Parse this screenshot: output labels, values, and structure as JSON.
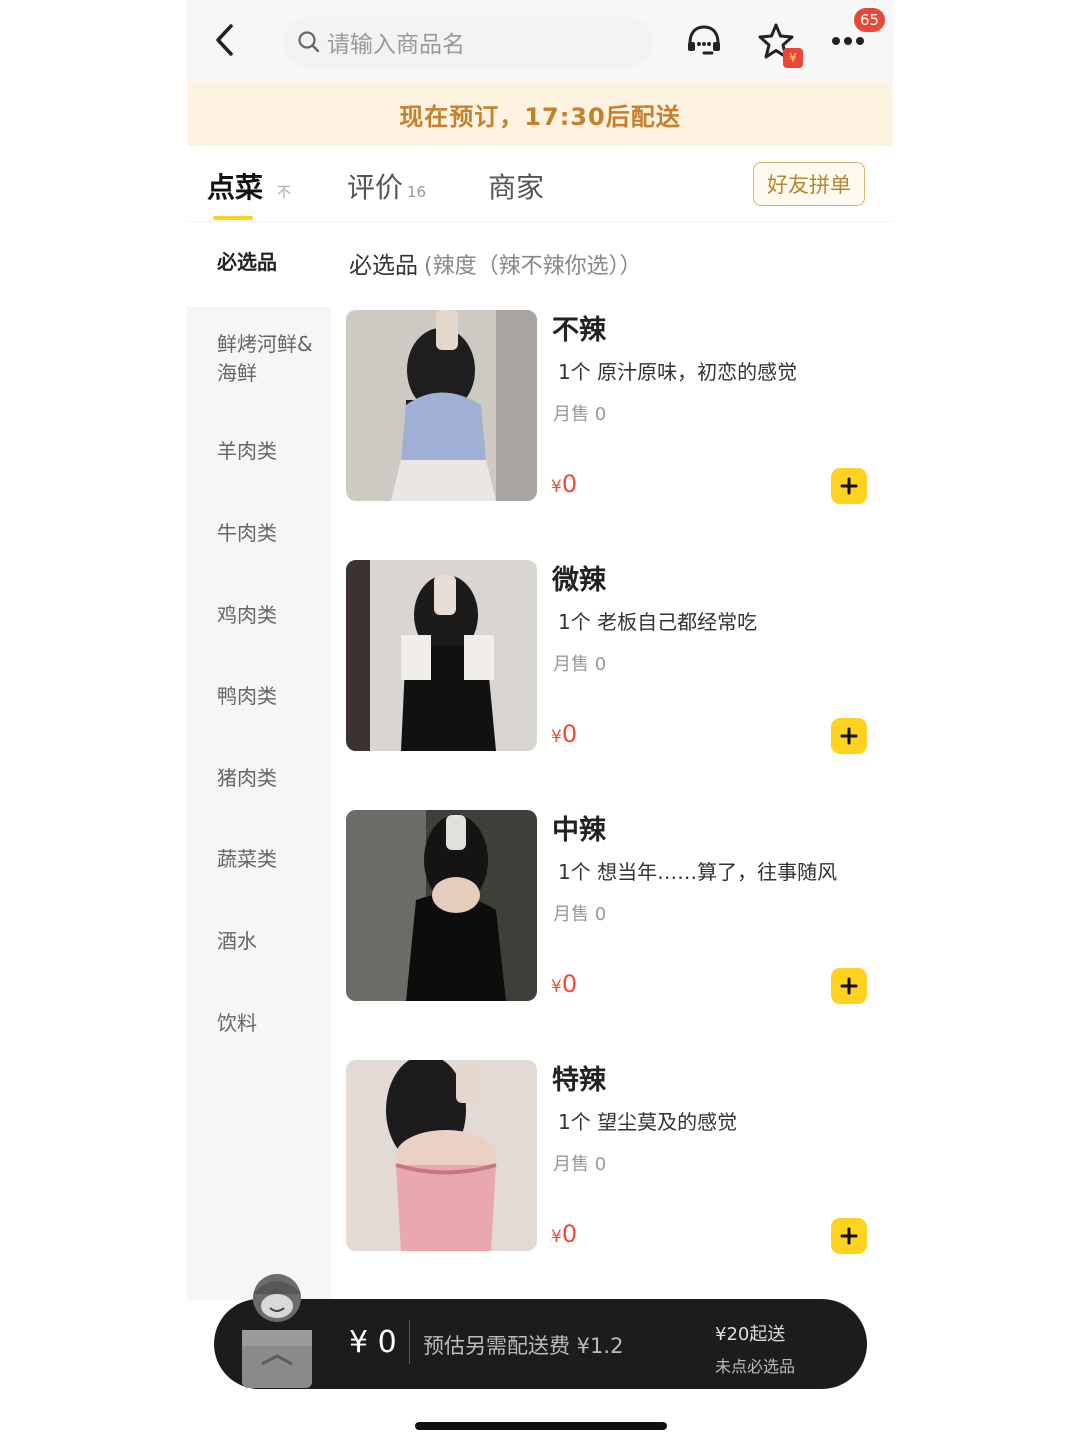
{
  "search": {
    "placeholder": "请输入商品名"
  },
  "header": {
    "badge_count": "65",
    "redpacket_label": "¥"
  },
  "banner": {
    "text": "现在预订，17:30后配送"
  },
  "tabs": {
    "order": "点菜",
    "order_pin": "不",
    "reviews": "评价",
    "reviews_count": "16",
    "merchant": "商家",
    "friend_button": "好友拼单"
  },
  "sidebar": {
    "items": [
      {
        "label": "必选品"
      },
      {
        "label": "鲜烤河鲜&海鲜"
      },
      {
        "label": "羊肉类"
      },
      {
        "label": "牛肉类"
      },
      {
        "label": "鸡肉类"
      },
      {
        "label": "鸭肉类"
      },
      {
        "label": "猪肉类"
      },
      {
        "label": "蔬菜类"
      },
      {
        "label": "酒水"
      },
      {
        "label": "饮料"
      }
    ]
  },
  "section": {
    "title": "必选品",
    "note": "(辣度（辣不辣你选））"
  },
  "products": [
    {
      "name": "不辣",
      "desc": "1个  原汁原味，初恋的感觉",
      "sales": "月售 0",
      "currency": "¥",
      "price": "0"
    },
    {
      "name": "微辣",
      "desc": "1个  老板自己都经常吃",
      "sales": "月售 0",
      "currency": "¥",
      "price": "0"
    },
    {
      "name": "中辣",
      "desc": "1个  想当年……算了，往事随风",
      "sales": "月售 0",
      "currency": "¥",
      "price": "0"
    },
    {
      "name": "特辣",
      "desc": "1个  望尘莫及的感觉",
      "sales": "月售 0",
      "currency": "¥",
      "price": "0"
    }
  ],
  "cart": {
    "price": "¥ 0",
    "delivery_fee": "预估另需配送费 ¥1.2",
    "min_order": "¥20起送",
    "required_hint": "未点必选品"
  },
  "colors": {
    "accent": "#ffd21f",
    "price": "#f04a3a",
    "banner_bg": "#fdf3e0",
    "banner_text": "#c67f2a"
  }
}
